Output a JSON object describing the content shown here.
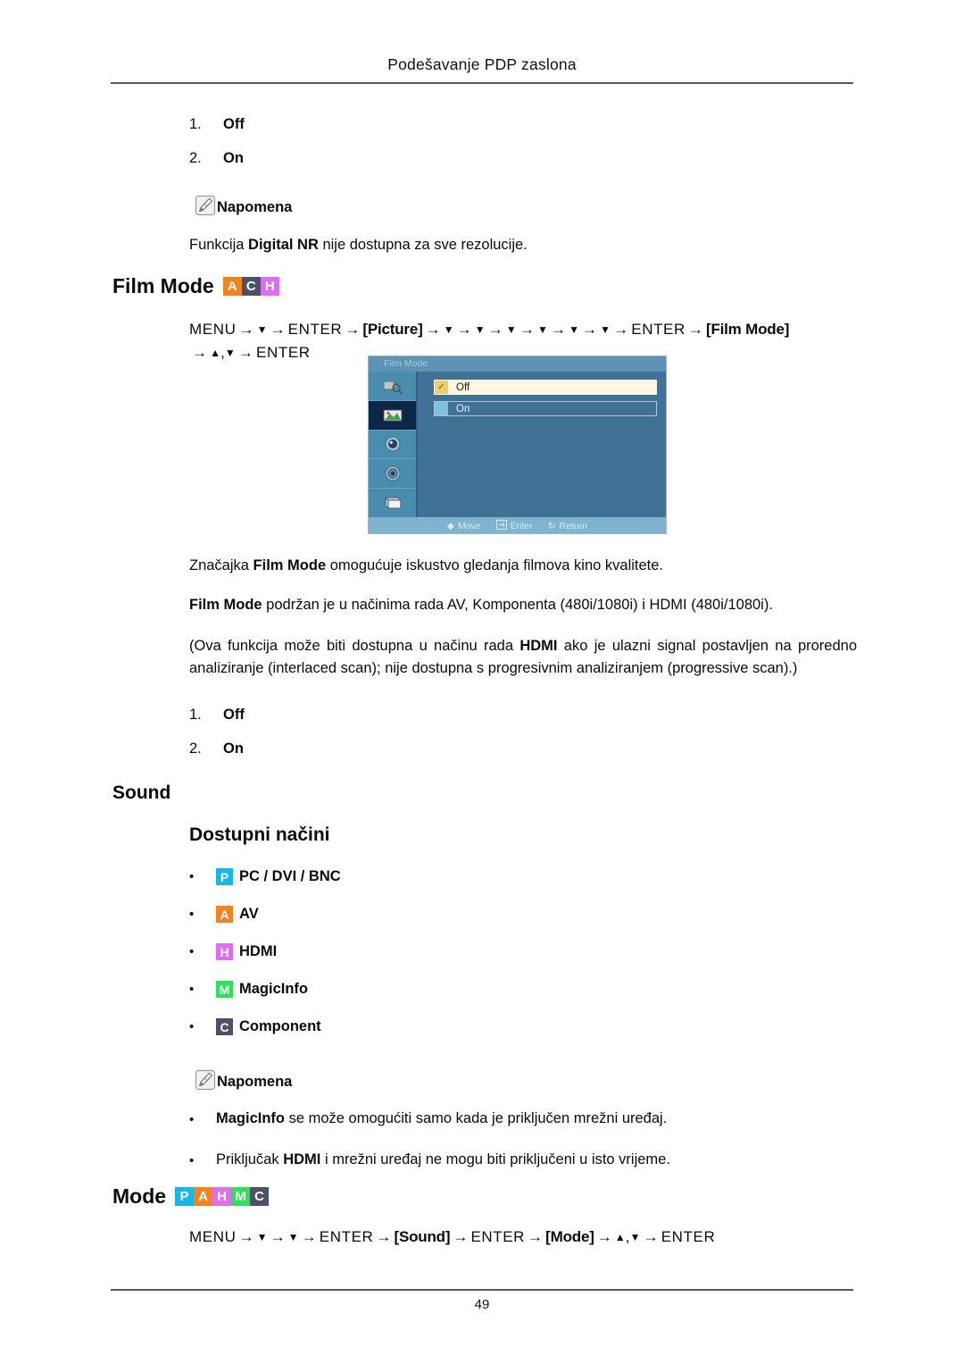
{
  "header": {
    "title": "Podešavanje PDP zaslona"
  },
  "footer": {
    "page_number": "49"
  },
  "top_list": {
    "items": [
      {
        "index": "1.",
        "label": "Off"
      },
      {
        "index": "2.",
        "label": "On"
      }
    ]
  },
  "note_top": {
    "icon": "note-pencil-icon",
    "label": "Napomena",
    "text_before": "Funkcija ",
    "text_bold": "Digital NR",
    "text_after": " nije dostupna za sve rezolucije."
  },
  "film_mode_section": {
    "heading": "Film Mode",
    "badges": [
      {
        "letter": "A",
        "color": "#f58220"
      },
      {
        "letter": "C",
        "color": "#4b5266"
      },
      {
        "letter": "H",
        "color": "#dd6ef0"
      }
    ],
    "menu_path": {
      "line1_parts": [
        "MENU",
        "→",
        "▼",
        "→",
        "ENTER",
        "→",
        "[Picture]",
        "→",
        "▼",
        "→",
        "▼",
        "→",
        "▼",
        "→",
        "▼",
        "→",
        "▼",
        "→",
        "▼",
        "→",
        "ENTER",
        "→",
        "[Film Mode]"
      ],
      "line2_parts": [
        "→",
        "▲",
        ",",
        "▼",
        "→",
        "ENTER"
      ],
      "menu_label": "MENU",
      "enter_label": "ENTER",
      "picture_label": "Picture",
      "film_mode_label": "Film Mode"
    },
    "osd": {
      "title": "Film Mode",
      "options": [
        {
          "label": "Off",
          "selected": true
        },
        {
          "label": "On",
          "selected": false
        }
      ],
      "sidebar_icons": [
        "input-source-icon",
        "picture-icon",
        "sound-icon",
        "setup-icon",
        "multi-control-icon"
      ],
      "footer": [
        {
          "icon": "move-diamond-icon",
          "label": "Move"
        },
        {
          "icon": "enter-icon",
          "label": "Enter"
        },
        {
          "icon": "return-icon",
          "label": "Return"
        }
      ]
    },
    "paragraph1": {
      "before": "Značajka ",
      "bold": "Film Mode",
      "after": " omogućuje iskustvo gledanja filmova kino kvalitete."
    },
    "paragraph2": {
      "bold": "Film Mode",
      "after": " podržan je u načinima rada AV, Komponenta (480i/1080i) i HDMI (480i/1080i)."
    },
    "paragraph3": {
      "part1": "(Ova funkcija može biti dostupna u načinu rada ",
      "bold": "HDMI",
      "part2": " ako je ulazni signal postavljen na proredno analiziranje (interlaced scan); nije dostupna s progresivnim analiziranjem (progressive scan).)"
    },
    "options_list": {
      "items": [
        {
          "index": "1.",
          "label": "Off"
        },
        {
          "index": "2.",
          "label": "On"
        }
      ]
    }
  },
  "sound_section": {
    "heading": "Sound",
    "subheading": "Dostupni načini",
    "modes": [
      {
        "badge": "P",
        "color": "#18b5e8",
        "label": "PC / DVI / BNC"
      },
      {
        "badge": "A",
        "color": "#f58220",
        "label": "AV"
      },
      {
        "badge": "H",
        "color": "#dd6ef0",
        "label": "HDMI"
      },
      {
        "badge": "M",
        "color": "#2ee05a",
        "label": "MagicInfo"
      },
      {
        "badge": "C",
        "color": "#4b5266",
        "label": "Component"
      }
    ],
    "note": {
      "icon": "note-pencil-icon",
      "label": "Napomena",
      "bullets": [
        {
          "bold": "MagicInfo",
          "text": " se može omogućiti samo kada je priključen mrežni uređaj."
        },
        {
          "before": "Priključak ",
          "bold": "HDMI",
          "text": " i mrežni uređaj ne mogu biti priključeni u isto vrijeme."
        }
      ]
    }
  },
  "mode_section": {
    "heading": "Mode",
    "badges": [
      {
        "letter": "P",
        "color": "#18b5e8"
      },
      {
        "letter": "A",
        "color": "#f58220"
      },
      {
        "letter": "H",
        "color": "#dd6ef0"
      },
      {
        "letter": "M",
        "color": "#2ee05a"
      },
      {
        "letter": "C",
        "color": "#4b5266"
      }
    ],
    "menu_path": {
      "menu_label": "MENU",
      "enter_label": "ENTER",
      "sound_label": "Sound",
      "mode_label": "Mode"
    }
  }
}
